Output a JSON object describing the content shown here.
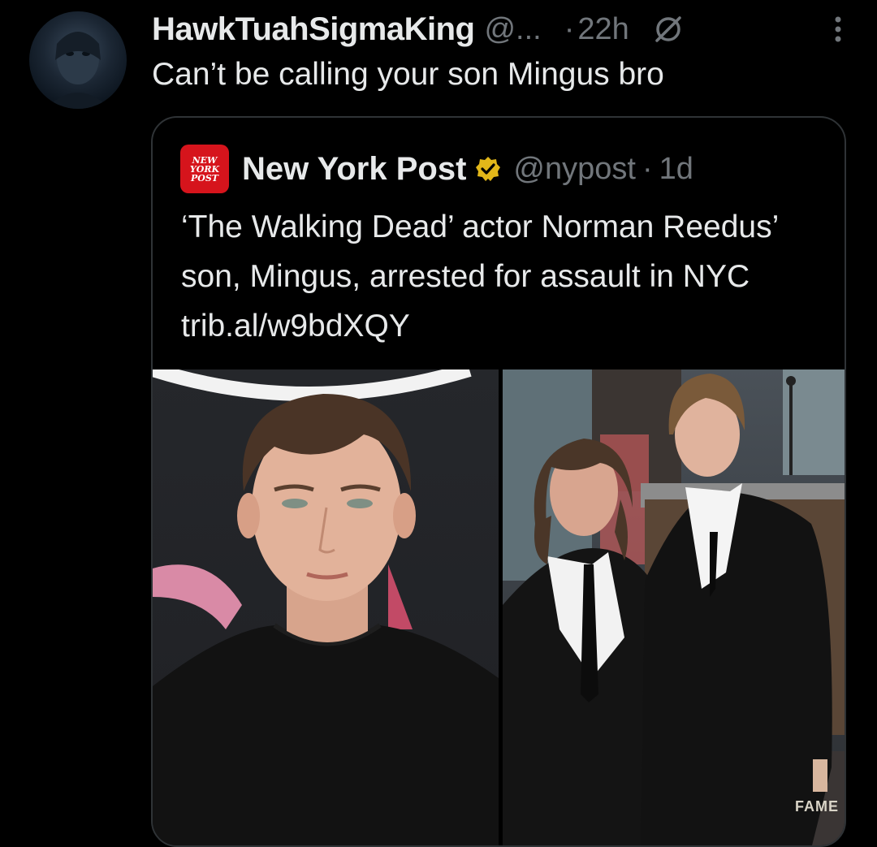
{
  "tweet": {
    "display_name": "HawkTuahSigmaKing",
    "handle": "@...",
    "separator": "·",
    "time": "22h",
    "text": "Can’t be calling your son Mingus bro"
  },
  "quoted_tweet": {
    "logo_lines": [
      "NEW",
      "YORK",
      "POST"
    ],
    "display_name": "New York Post",
    "handle": "@nypost",
    "separator": "·",
    "time": "1d",
    "text": "‘The Walking Dead’ actor Norman Reedus’ son, Mingus, arrested for assault in NYC trib.al/w9bdXQY",
    "verified": true
  },
  "media": {
    "right_photo_sign_text": "FAME"
  },
  "icons": {
    "avatar": "avatar-image",
    "grok": "grok-icon",
    "more": "more-options-icon",
    "verified": "verified-badge-icon"
  },
  "colors": {
    "background": "#000000",
    "primary_text": "#e7e9ea",
    "secondary_text": "#71767b",
    "border": "#2f3336",
    "nypost_red": "#d6141c",
    "verified_gold": "#e2b719"
  }
}
